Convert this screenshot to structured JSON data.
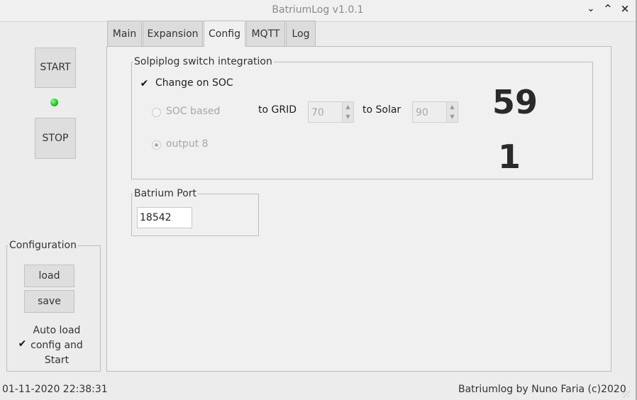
{
  "window": {
    "title": "BatriumLog v1.0.1",
    "controls": {
      "minimize": "⌄",
      "maximize": "^",
      "close": "×"
    }
  },
  "sidebar": {
    "start_label": "START",
    "stop_label": "STOP",
    "status_led": {
      "color": "#22d022",
      "state": "on"
    },
    "configuration": {
      "title": "Configuration",
      "load_label": "load",
      "save_label": "save",
      "autoload": {
        "checked": true,
        "line1": "Auto load",
        "line2": "config and",
        "line3": "Start"
      }
    }
  },
  "tabs": [
    {
      "label": "Main",
      "active": false
    },
    {
      "label": "Expansion",
      "active": false
    },
    {
      "label": "Config",
      "active": true
    },
    {
      "label": "MQTT",
      "active": false
    },
    {
      "label": "Log",
      "active": false
    }
  ],
  "config": {
    "solpiplog": {
      "title": "Solpiplog switch integration",
      "change_on_soc": {
        "label": "Change on SOC",
        "checked": true
      },
      "soc_based": {
        "label": "SOC based",
        "selected": false
      },
      "output8": {
        "label": "output 8",
        "selected": true
      },
      "to_grid": {
        "label": "to GRID",
        "value": "70"
      },
      "to_solar": {
        "label": "to Solar",
        "value": "90"
      },
      "soc_display": "59",
      "output_display": "1"
    },
    "batrium_port": {
      "title": "Batrium Port",
      "value": "18542"
    }
  },
  "statusbar": {
    "datetime": "01-11-2020 22:38:31",
    "credit": "Batriumlog by Nuno Faria (c)2020"
  }
}
